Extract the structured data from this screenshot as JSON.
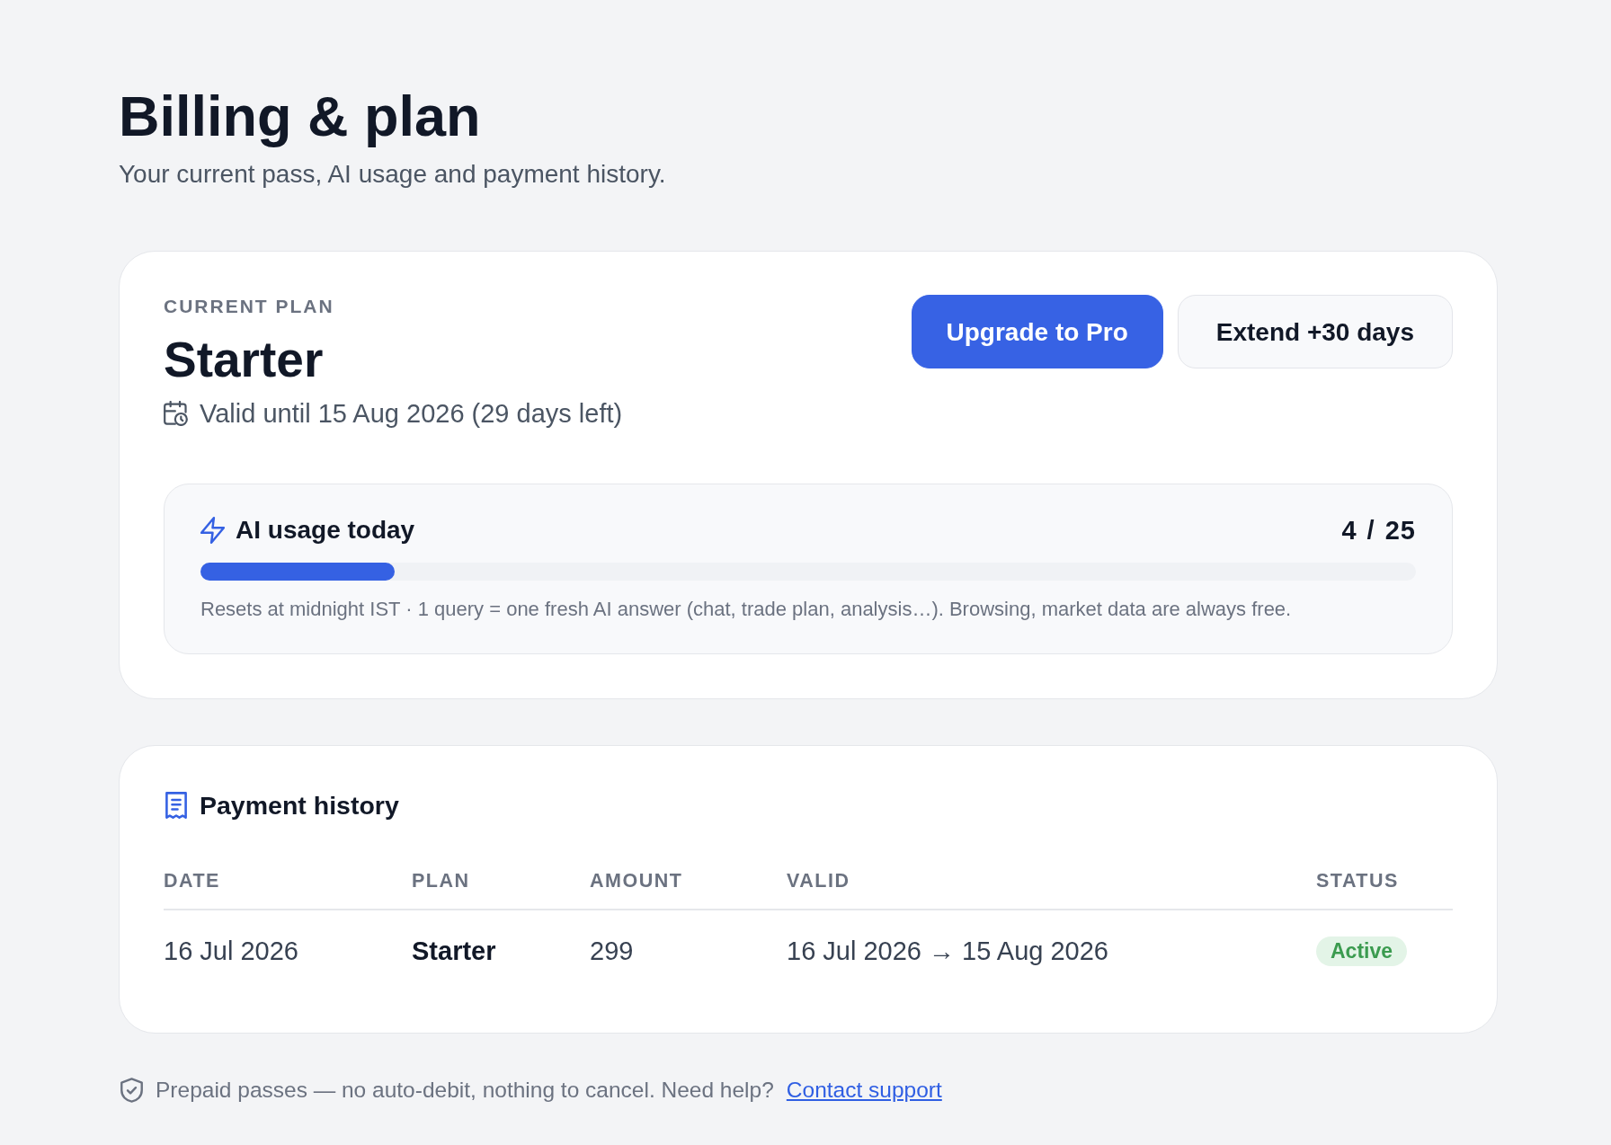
{
  "header": {
    "title": "Billing & plan",
    "subtitle": "Your current pass, AI usage and payment history."
  },
  "current_plan": {
    "label": "CURRENT PLAN",
    "name": "Starter",
    "validity": "Valid until 15 Aug 2026 (29 days left)",
    "buttons": [
      {
        "label": "Upgrade to Pro",
        "kind": "primary"
      },
      {
        "label": "Extend +30 days",
        "kind": "secondary"
      }
    ],
    "ai_usage": {
      "title": "AI usage today",
      "count": "4 / 25",
      "level": 0.16,
      "note": "Resets at midnight IST · 1 query = one fresh AI answer (chat, trade plan, analysis…). Browsing, market data are always free."
    }
  },
  "payment_history": {
    "title": "Payment history",
    "columns": [
      "DATE",
      "PLAN",
      "AMOUNT",
      "VALID",
      "STATUS"
    ],
    "rows": [
      {
        "date": "16 Jul 2026",
        "plan": "Starter",
        "amount": "299",
        "valid": "16 Jul 2026 → 15 Aug 2026",
        "status": {
          "label": "Active",
          "kind": "success"
        }
      }
    ]
  },
  "footer": {
    "text": "Prepaid passes — no auto-debit, nothing to cancel. Need help?",
    "link": "Contact support"
  }
}
